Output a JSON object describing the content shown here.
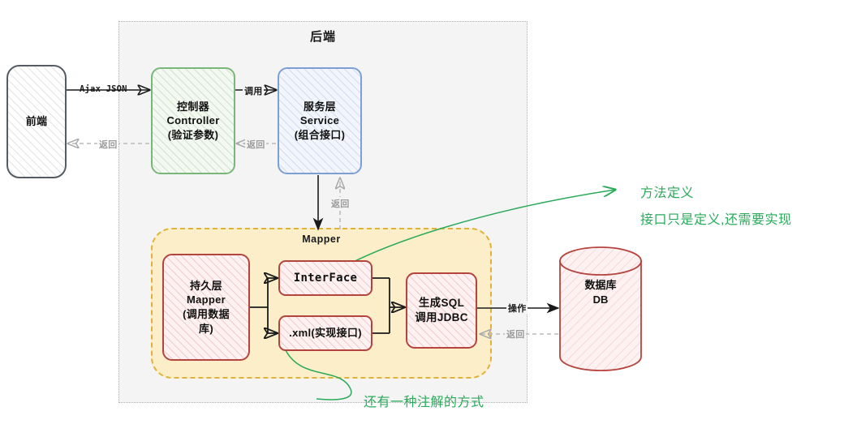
{
  "diagram": {
    "backend_container_label": "后端",
    "mapper_container_label": "Mapper",
    "nodes": {
      "frontend": {
        "label": "前端"
      },
      "controller": {
        "line1": "控制器",
        "line2": "Controller",
        "line3": "(验证参数)"
      },
      "service": {
        "line1": "服务层",
        "line2": "Service",
        "line3": "(组合接口)"
      },
      "persistence": {
        "line1": "持久层",
        "line2": "Mapper",
        "line3": "(调用数据",
        "line4": "库)"
      },
      "interface": {
        "label": "InterFace"
      },
      "xml_impl": {
        "label": ".xml(实现接口)"
      },
      "sql_jdbc": {
        "line1": "生成SQL",
        "line2": "调用JDBC"
      },
      "database": {
        "line1": "数据库",
        "line2": "DB"
      }
    },
    "edges": {
      "frontend_to_controller": "Ajax JSON",
      "controller_to_frontend": "返回",
      "controller_to_service": "调用",
      "service_to_controller": "返回",
      "mapper_to_service": "返回",
      "sql_to_db": "操作",
      "db_to_sql": "返回"
    },
    "annotations": {
      "interface_note_line1": "方法定义",
      "interface_note_line2": "接口只是定义,还需要实现",
      "xml_note": "还有一种注解的方式"
    },
    "colors": {
      "backend_bg": "#f4f4f4",
      "backend_border": "#b0b0b0",
      "mapper_bg": "#fbeec8",
      "mapper_border": "#e0b23c",
      "controller_border": "#79b779",
      "service_border": "#7d9fd4",
      "persistence_border": "#b5443f",
      "frontend_border": "#555c63",
      "annotation_green": "#2aaa5a",
      "return_gray": "#9a9a9a",
      "solid_arrow": "#1a1a1a"
    }
  }
}
